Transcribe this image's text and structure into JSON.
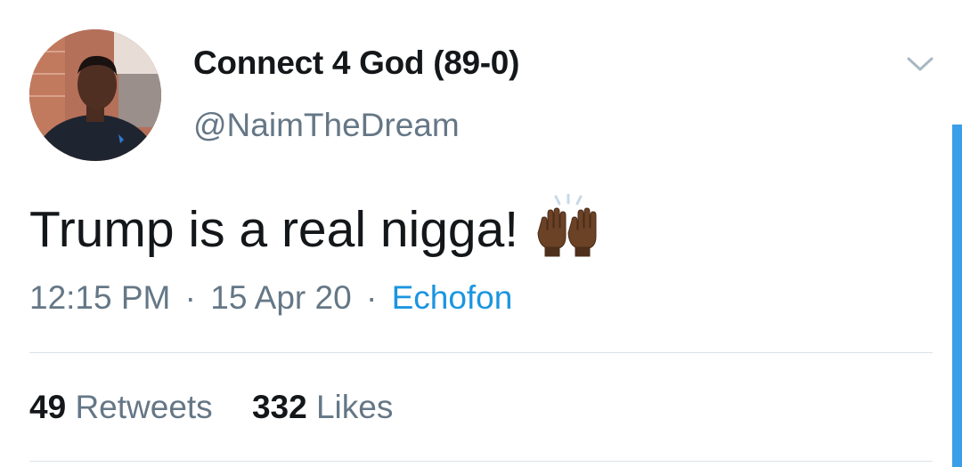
{
  "user": {
    "display_name": "Connect 4 God (89-0)",
    "handle": "@NaimTheDream"
  },
  "tweet": {
    "text": "Trump is a real nigga!",
    "emoji": "raising-hands-emoji",
    "time": "12:15 PM",
    "separator": "·",
    "date": "15 Apr 20",
    "source": "Echofon"
  },
  "stats": {
    "retweets_count": "49",
    "retweets_label": "Retweets",
    "likes_count": "332",
    "likes_label": "Likes"
  },
  "icons": {
    "menu": "chevron-down-icon"
  },
  "colors": {
    "link": "#1b95e0",
    "secondary_text": "#657786",
    "primary_text": "#14171a",
    "scrollbar": "#3a9ee8"
  }
}
